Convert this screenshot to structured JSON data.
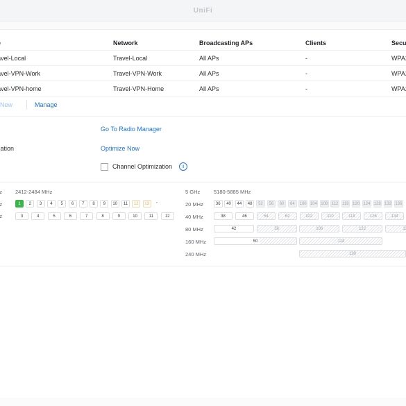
{
  "window": {
    "title": "UniFi"
  },
  "table": {
    "headers": [
      "me",
      "Network",
      "Broadcasting APs",
      "Clients",
      "Secu"
    ],
    "rows": [
      [
        "Travel-Local",
        "Travel-Local",
        "All APs",
        "-",
        "WPA2"
      ],
      [
        "Travel-VPN-Work",
        "Travel-VPN-Work",
        "All APs",
        "-",
        "WPA2"
      ],
      [
        "Travel-VPN-home",
        "Travel-VPN-Home",
        "All APs",
        "-",
        "WPA2"
      ]
    ]
  },
  "actions": {
    "create_label": "te New",
    "manage_label": "Manage"
  },
  "settings": {
    "radios_label": "os",
    "radio_manager_link": "Go To Radio Manager",
    "channelization_label": "nelization",
    "optimize_link": "Optimize Now",
    "channel_optimization_label": "Channel Optimization",
    "info_glyph": "i"
  },
  "band24": {
    "title": "Hz",
    "range": "2412-2484 MHz",
    "row20_label": "Hz",
    "row40_label": "Hz",
    "row20": [
      "1",
      "2",
      "3",
      "4",
      "5",
      "6",
      "7",
      "8",
      "9",
      "10",
      "11",
      "12",
      "13",
      "-"
    ],
    "row20_active": "1",
    "row20_warn": [
      "12",
      "13"
    ],
    "row40": [
      "3",
      "4",
      "5",
      "6",
      "7",
      "8",
      "9",
      "10",
      "11",
      "12"
    ]
  },
  "band5": {
    "title": "5 GHz",
    "range": "5180-5885 MHz",
    "row20_label": "20 MHz",
    "row40_label": "40 MHz",
    "row80_label": "80 MHz",
    "row160_label": "160 MHz",
    "row240_label": "240 MHz",
    "row20": [
      "36",
      "40",
      "44",
      "48",
      "52",
      "56",
      "60",
      "64",
      "100",
      "104",
      "108",
      "112",
      "116",
      "120",
      "124",
      "128",
      "132",
      "136"
    ],
    "row40": [
      "38",
      "46",
      "54",
      "62",
      "102",
      "110",
      "118",
      "126",
      "134"
    ],
    "row80": [
      "42",
      "58",
      "106",
      "122",
      "13"
    ],
    "row160": [
      "50",
      "114"
    ],
    "row240": [
      "130"
    ]
  },
  "colors": {
    "accent": "#1e73d8",
    "active_channel": "#39b54a",
    "warn_channel": "#f0a848"
  }
}
